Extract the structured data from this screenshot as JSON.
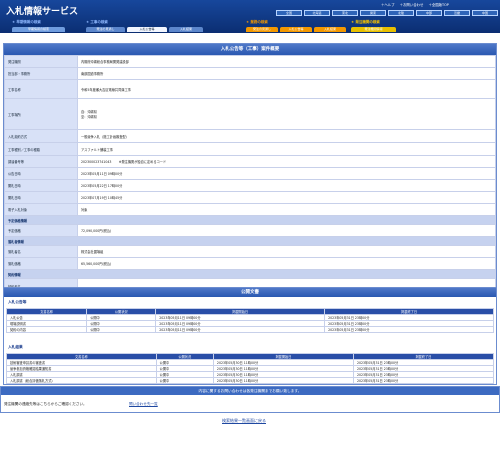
{
  "header": {
    "title": "入札情報サービス",
    "links": [
      "＋ヘルプ",
      "＋お問い合わせ",
      "＋全国版TOP"
    ],
    "regions": [
      "全国",
      "北海道",
      "東北",
      "関東",
      "北陸",
      "中部",
      "近畿",
      "中国",
      "四国",
      "九州・沖縄"
    ],
    "groups": [
      "★ 早期情報の検索",
      "★ 工事の検索",
      "★ 業務の検索",
      "★ 発注機関の検索"
    ],
    "tabs": [
      "早期情報の検索",
      "発注の見通し",
      "入札公告等",
      "入札結果",
      "発注の見通し",
      "入札公告等",
      "入札結果",
      "発注機関情報"
    ]
  },
  "colors": {
    "primary": "#15489e",
    "accent": "#f39800",
    "label": "#d8e1f7",
    "section": "#c6d2ef"
  },
  "notice_panel": {
    "title": "入札公告等（工事）案件概要",
    "rows": [
      {
        "label": "発注機関",
        "value": "内閣府沖縄総合事務局開発建設部"
      },
      {
        "label": "担当部・事務所",
        "value": "南部国道事務所"
      },
      {
        "label": "工事名称",
        "value": "令和5年度瀬大吉区電線共同溝工事"
      },
      {
        "label": "工事場所",
        "value": "自：沖縄県\n至：沖縄県"
      },
      {
        "label": "入札契約方式",
        "value": "一般競争入札（施工計画審査型）"
      },
      {
        "label": "工事種別／工事の種類",
        "value": "アスファルト舗装工事"
      },
      {
        "label": "調達番号等",
        "value": "202300023741043 　　※発注機関が独自に定めるコード"
      },
      {
        "label": "公告日時",
        "value": "2023年05月11日 09時00分"
      },
      {
        "label": "開札日時",
        "value": "2023年05月22日 17時00分"
      },
      {
        "label": "開札日時",
        "value": "2023年07月19日 10時45分"
      },
      {
        "label": "電子入札対象",
        "value": "対象"
      },
      {
        "section": "予定価格情報"
      },
      {
        "label": "予定価格",
        "value": "72,090,000円(税込)"
      },
      {
        "section": "落札者情報"
      },
      {
        "label": "落札者名",
        "value": "株式会社國場組"
      },
      {
        "label": "落札価格",
        "value": "65,560,000円(税込)"
      },
      {
        "section": "契約情報"
      },
      {
        "label": "契約者名",
        "value": ""
      },
      {
        "label": "契約金額",
        "value": ""
      }
    ]
  },
  "documents": {
    "title": "公開文書",
    "headers": [
      "文書名称",
      "公開状況",
      "掲載開始日",
      "掲載終了日"
    ],
    "sections": [
      {
        "name": "入札公告等",
        "rows": [
          [
            "入札公告",
            "公開中",
            "2023年05月11日 09時00分",
            "2023年05月31日 23時00分"
          ],
          [
            "現場説明書",
            "公開中",
            "2023年05月11日 09時00分",
            "2023年05月31日 23時00分"
          ],
          [
            "契約の内容",
            "公開中",
            "2023年05月11日 09時00分",
            "2023年05月31日 23時00分"
          ]
        ]
      },
      {
        "name": "入札結果",
        "rows": [
          [
            "技術審査申請書の審査書",
            "公開中",
            "2023年05月30日 11時00分",
            "2023年05月31日 23時00分"
          ],
          [
            "競争参加資格確認結果通知書",
            "公開中",
            "2023年05月30日 11時00分",
            "2023年05月31日 23時00分"
          ],
          [
            "入札調書",
            "公開中",
            "2023年05月30日 11時00分",
            "2023年05月31日 23時00分"
          ],
          [
            "入札調書（総合評価落札方式）",
            "公開中",
            "2023年05月30日 11時00分",
            "2023年05月31日 23時00分"
          ]
        ]
      }
    ]
  },
  "contact": {
    "title": "内容に関するお問い合わせは各発注機関までお願い致します。",
    "left": "発注機関の連絡先等はこちらからご確認ください。",
    "link": "問い合わせ先一覧"
  },
  "back_link": "検索結果一覧画面に戻る"
}
